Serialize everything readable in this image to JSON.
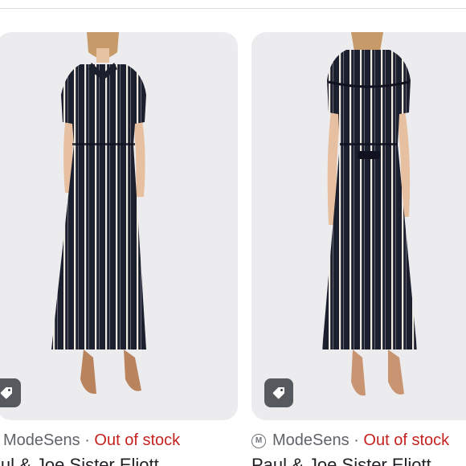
{
  "results": [
    {
      "source": "ModeSens",
      "separator": "·",
      "availability": "Out of stock",
      "title": "Paul & Joe Sister Eliott",
      "tag_icon": "price-tag-icon",
      "view": "front"
    },
    {
      "source": "ModeSens",
      "separator": "·",
      "availability": "Out of stock",
      "title": "Paul & Joe Sister Eliott",
      "source_logo": "M",
      "tag_icon": "price-tag-icon",
      "view": "back"
    }
  ],
  "colors": {
    "out_of_stock": "#c5221f",
    "card_background": "#ececee",
    "garment": "#1c1f2e",
    "stripe": "#efe9df"
  }
}
